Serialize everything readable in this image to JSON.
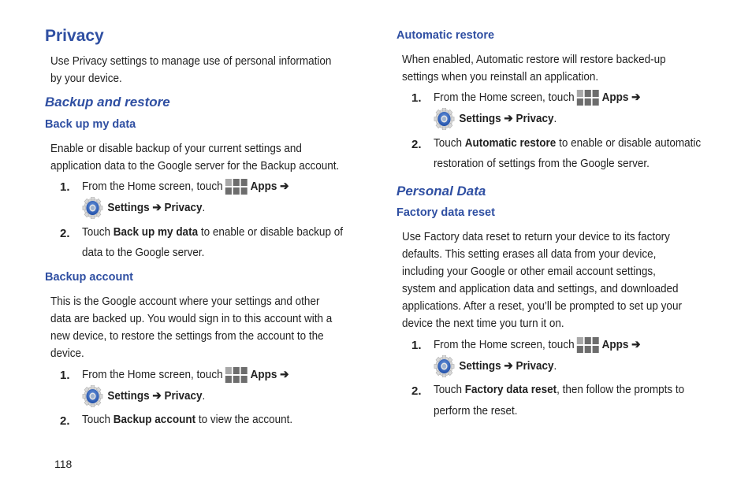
{
  "page": {
    "title": "Privacy",
    "intro": [
      "Use Privacy settings to manage use of personal information",
      "by your device."
    ],
    "page_number": "118"
  },
  "backup_restore": {
    "heading": "Backup and restore",
    "backup_my_data": {
      "heading": "Back up my data",
      "body": [
        "Enable or disable backup of your current settings and",
        "application data to the Google server for the Backup account."
      ],
      "step1": {
        "num": "1.",
        "pre": "From the Home screen, touch",
        "apps": "Apps",
        "arrow": "➔",
        "settings": "Settings ➔ Privacy",
        "end": "."
      },
      "step2": {
        "num": "2.",
        "pre": "Touch ",
        "bold": "Back up my data",
        "post": " to enable or disable backup of",
        "line2": "data to the Google server."
      }
    },
    "backup_account": {
      "heading": "Backup account",
      "body": [
        "This is the Google account where your settings and other",
        "data are backed up. You would sign in to this account with a",
        "new device, to restore the settings from the account to the",
        "device."
      ],
      "step1": {
        "num": "1.",
        "pre": "From the Home screen, touch",
        "apps": "Apps",
        "arrow": "➔",
        "settings": "Settings ➔ Privacy",
        "end": "."
      },
      "step2": {
        "num": "2.",
        "pre": "Touch ",
        "bold": "Backup account",
        "post": " to view the account."
      }
    },
    "automatic_restore": {
      "heading": "Automatic restore",
      "body": [
        "When enabled, Automatic restore will restore backed-up",
        "settings when you reinstall an application."
      ],
      "step1": {
        "num": "1.",
        "pre": "From the Home screen, touch",
        "apps": "Apps",
        "arrow": "➔",
        "settings": "Settings ➔ Privacy",
        "end": "."
      },
      "step2": {
        "num": "2.",
        "pre": "Touch ",
        "bold": "Automatic restore",
        "post": " to enable or disable automatic",
        "line2": "restoration of settings from the Google server."
      }
    }
  },
  "personal_data": {
    "heading": "Personal Data",
    "factory_reset": {
      "heading": "Factory data reset",
      "body": [
        "Use Factory data reset to return your device to its factory",
        "defaults. This setting erases all data from your device,",
        "including your Google or other email account settings,",
        "system and application data and settings, and downloaded",
        "applications. After a reset, you’ll be prompted to set up your",
        "device the next time you turn it on."
      ],
      "step1": {
        "num": "1.",
        "pre": "From the Home screen, touch",
        "apps": "Apps",
        "arrow": "➔",
        "settings": "Settings ➔ Privacy",
        "end": "."
      },
      "step2": {
        "num": "2.",
        "pre": "Touch ",
        "bold": "Factory data reset",
        "post": ", then follow the prompts to",
        "line2": "perform the reset."
      }
    }
  },
  "colors": {
    "heading": "#2f4fa2",
    "text": "#222222"
  }
}
